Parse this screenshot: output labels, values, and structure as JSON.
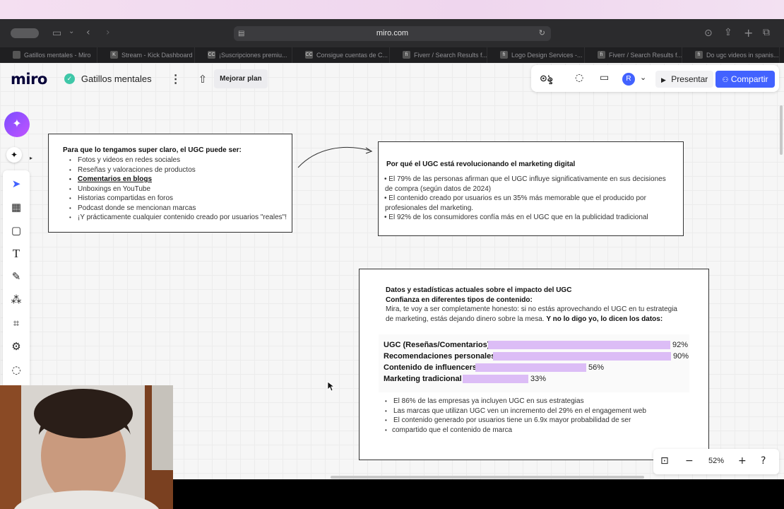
{
  "browser": {
    "url": "miro.com",
    "tabs": [
      {
        "label": "Gatillos mentales - Miro",
        "fav": ""
      },
      {
        "label": "Stream - Kick Dashboard",
        "fav": "K"
      },
      {
        "label": "¡Suscripciones premiu...",
        "fav": "CC"
      },
      {
        "label": "Consigue cuentas de C...",
        "fav": "CC"
      },
      {
        "label": "Fiverr / Search Results f...",
        "fav": "fi"
      },
      {
        "label": "Logo Design Services -...",
        "fav": "fi"
      },
      {
        "label": "Fiverr / Search Results f...",
        "fav": "fi"
      },
      {
        "label": "Do ugc videos in spanis...",
        "fav": "fi"
      }
    ]
  },
  "header": {
    "logo": "miro",
    "board_title": "Gatillos mentales",
    "upgrade_label": "Mejorar plan",
    "avatar_initial": "R",
    "present_label": "Presentar",
    "share_label": "Compartir"
  },
  "board1": {
    "heading": "Para que lo tengamos super claro, el UGC puede ser:",
    "items": [
      "Fotos y videos en redes sociales",
      "Reseñas y valoraciones de productos",
      "Comentarios en blogs",
      "Unboxings en YouTube",
      "Historias compartidas en foros",
      "Podcast donde se mencionan marcas",
      "¡Y prácticamente cualquier contenido creado por usuarios \"reales\"!"
    ]
  },
  "board2": {
    "heading": "Por qué el UGC está revolucionando el marketing digital",
    "items": [
      "El 79% de las personas afirman que el UGC influye significativamente en sus decisiones",
      "de compra (según datos de 2024)",
      "El contenido creado por usuarios es un 35% más memorable que el producido por",
      "profesionales del marketing.",
      "El 92% de los consumidores confía más en el UGC que en la publicidad tradicional"
    ]
  },
  "board3": {
    "heading": "Datos y estadísticas actuales sobre el impacto del UGC",
    "subheading": "Confianza en diferentes tipos de contenido:",
    "para_line1": "Mira, te voy a ser completamente honesto: si no estás aprovechando el UGC en tu estrategia",
    "para_line2": "de marketing, estás dejando dinero sobre la mesa.",
    "para_bold": "Y no lo digo yo, lo dicen los datos:",
    "items": [
      "El 86% de las empresas ya incluyen UGC en sus estrategias",
      "Las marcas que utilizan UGC ven un incremento del 29% en el engagement web",
      "El contenido generado por usuarios tiene un 6.9x mayor probabilidad de ser",
      "compartido que el contenido de marca"
    ]
  },
  "chart_data": {
    "type": "bar",
    "categories": [
      "UGC (Reseñas/Comentarios)",
      "Recomendaciones personales",
      "Contenido de influencers",
      "Marketing tradicional"
    ],
    "values": [
      92,
      90,
      56,
      33
    ],
    "value_labels": [
      "92%",
      "90%",
      "56%",
      "33%"
    ],
    "color": "#dcbdf6"
  },
  "zoom": {
    "level": "52%"
  },
  "colors": {
    "accent": "#4262ff",
    "bar": "#dcbdf6",
    "ai": "#7b4dff"
  }
}
